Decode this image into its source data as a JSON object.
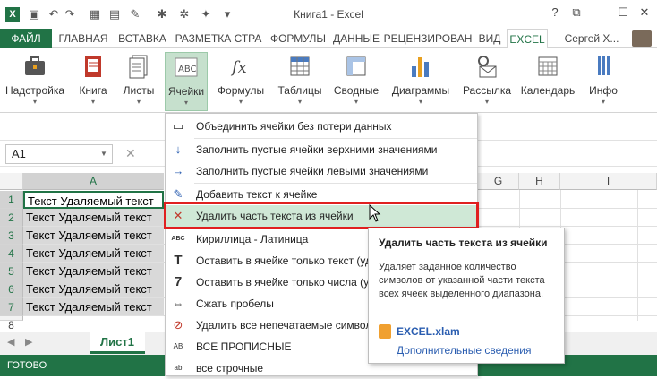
{
  "window": {
    "title": "Книга1 - Excel",
    "controls": [
      "?",
      "⧉",
      "—",
      "☐",
      "✕"
    ]
  },
  "tabs": {
    "file": "ФАЙЛ",
    "items": [
      "ГЛАВНАЯ",
      "ВСТАВКА",
      "РАЗМЕТКА СТРА",
      "ФОРМУЛЫ",
      "ДАННЫЕ",
      "РЕЦЕНЗИРОВАН",
      "ВИД",
      "EXCEL"
    ],
    "user": "Сергей Х..."
  },
  "ribbon": {
    "buttons": [
      "Надстройка",
      "Книга",
      "Листы",
      "Ячейки",
      "Формулы",
      "Таблицы",
      "Сводные",
      "Диаграммы",
      "Рассылка",
      "Календарь",
      "Инфо"
    ]
  },
  "formula_bar": {
    "name_box": "A1",
    "fx": "fx"
  },
  "grid": {
    "columns": [
      "A",
      "G",
      "H",
      "I"
    ],
    "rows": [
      "1",
      "2",
      "3",
      "4",
      "5",
      "6",
      "7",
      "8"
    ],
    "cells": [
      "Текст Удаляемый текст",
      "Текст Удаляемый текст",
      "Текст Удаляемый текст",
      "Текст Удаляемый текст",
      "Текст Удаляемый текст",
      "Текст Удаляемый текст",
      "Текст Удаляемый текст"
    ]
  },
  "menu": {
    "items": [
      "Объединить ячейки без потери данных",
      "Заполнить пустые ячейки верхними значениями",
      "Заполнить пустые ячейки левыми значениями",
      "Добавить текст к ячейке",
      "Удалить часть текста из ячейки",
      "Кириллица - Латиница",
      "Оставить в ячейке только текст (уд",
      "Оставить в ячейке только числа (у",
      "Сжать пробелы",
      "Удалить все непечатаемые символ",
      "ВСЕ ПРОПИСНЫЕ",
      "все строчные"
    ]
  },
  "tooltip": {
    "title": "Удалить часть текста из ячейки",
    "body": "Удаляет заданное количество символов от указанной части текста всех ячеек выделенного диапазона.",
    "file": "EXCEL.xlam",
    "link": "Дополнительные сведения"
  },
  "sheet": {
    "tab": "Лист1"
  },
  "status": {
    "text": "ГОТОВО"
  },
  "colors": {
    "excel_green": "#217346",
    "highlight": "#cfe8d6",
    "red_box": "#e02020"
  }
}
